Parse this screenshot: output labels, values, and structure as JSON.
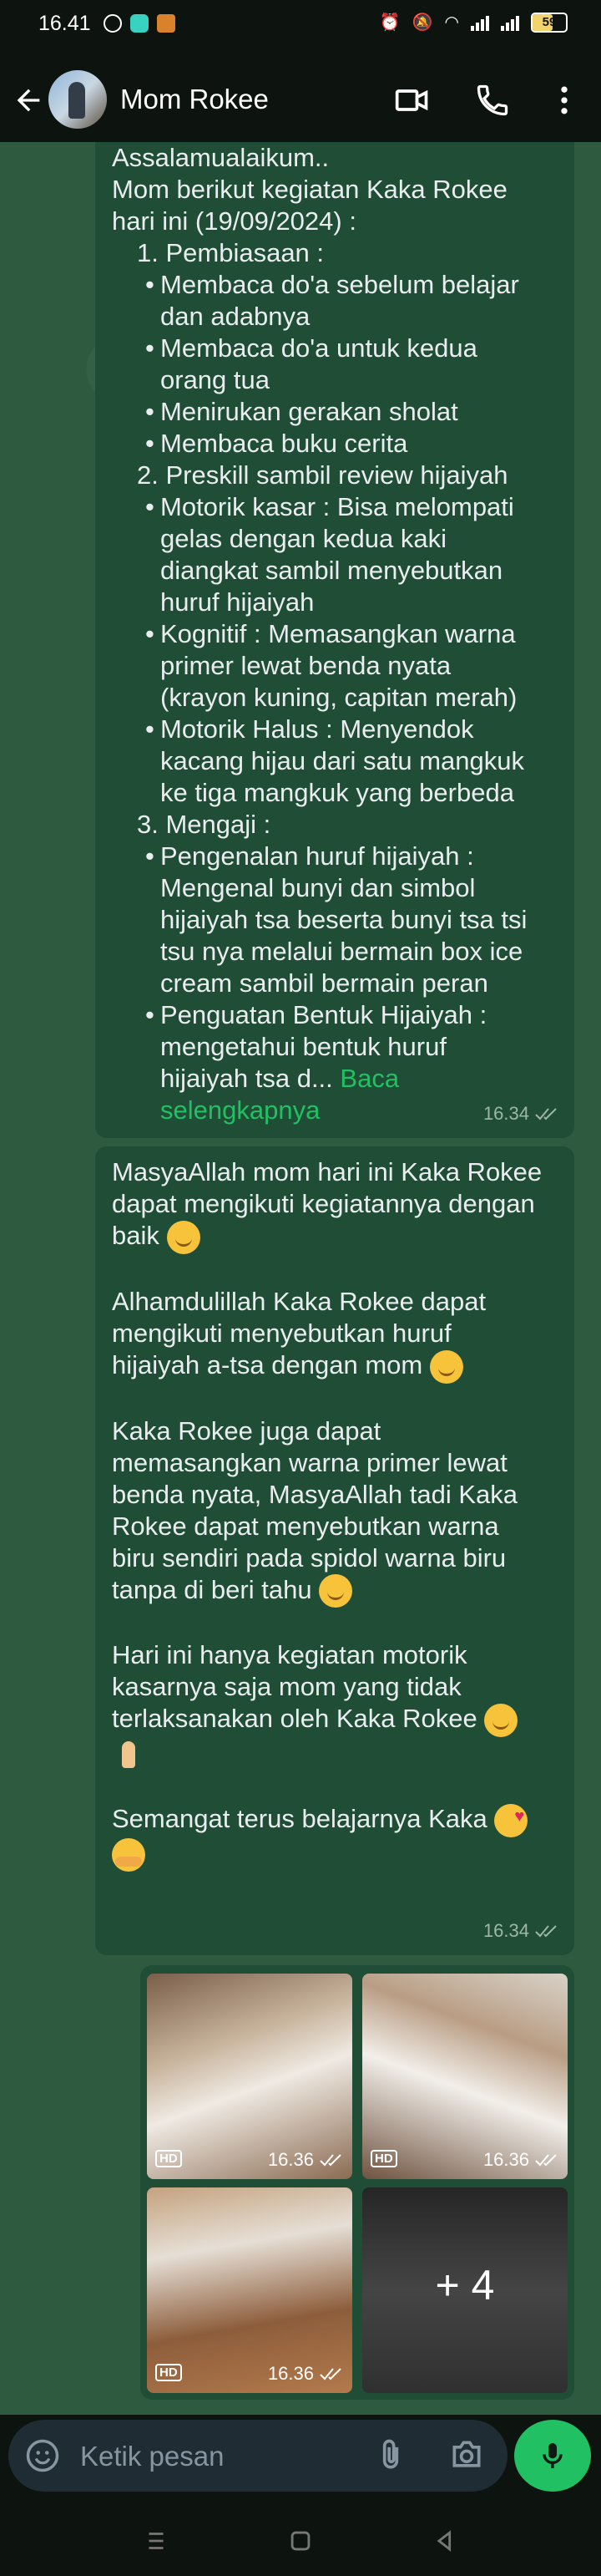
{
  "status_bar": {
    "time": "16.41",
    "battery": "59"
  },
  "header": {
    "contact_name": "Mom Rokee"
  },
  "message1": {
    "lines": [
      "Assalamualaikum..",
      "Mom berikut kegiatan Kaka Rokee",
      "hari ini (19/09/2024) :"
    ],
    "list": [
      {
        "kind": "num",
        "text": "1. Pembiasaan :"
      },
      {
        "kind": "bul",
        "text": [
          "Membaca do'a sebelum belajar",
          "dan adabnya"
        ]
      },
      {
        "kind": "bul",
        "text": [
          "Membaca do'a untuk kedua",
          "orang tua"
        ]
      },
      {
        "kind": "bul",
        "text": [
          "Menirukan gerakan sholat"
        ]
      },
      {
        "kind": "bul",
        "text": [
          "Membaca buku cerita"
        ]
      },
      {
        "kind": "num",
        "text": "2. Preskill sambil review hijaiyah"
      },
      {
        "kind": "bul",
        "text": [
          "Motorik kasar :   Bisa melompati",
          "gelas dengan kedua kaki",
          "diangkat sambil menyebutkan",
          "huruf hijaiyah"
        ]
      },
      {
        "kind": "bul",
        "text": [
          "Kognitif : Memasangkan warna",
          "primer lewat benda nyata",
          "(krayon kuning, capitan merah)"
        ]
      },
      {
        "kind": "bul",
        "text": [
          "Motorik Halus :   Menyendok",
          "kacang hijau dari satu mangkuk",
          "ke tiga mangkuk yang berbeda"
        ]
      },
      {
        "kind": "num",
        "text": "3. Mengaji :"
      },
      {
        "kind": "bul",
        "text": [
          "Pengenalan huruf hijaiyah :",
          "Mengenal bunyi dan simbol",
          "hijaiyah tsa beserta bunyi tsa tsi",
          "tsu nya melalui bermain box ice",
          "cream sambil bermain peran"
        ]
      },
      {
        "kind": "bul",
        "text": [
          "Penguatan Bentuk Hijaiyah :",
          "mengetahui bentuk huruf"
        ]
      }
    ],
    "last_line": "hijaiyah tsa d...",
    "read_more": "Baca",
    "read_more_2": "selengkapnya",
    "time": "16.34"
  },
  "message2": {
    "paragraphs": [
      [
        "MasyaAllah mom hari ini Kaka Rokee",
        "dapat mengikuti kegiatannya dengan",
        "baik"
      ],
      [
        "Alhamdulillah Kaka Rokee dapat",
        "mengikuti menyebutkan huruf",
        "hijaiyah a-tsa dengan mom"
      ],
      [
        "Kaka Rokee juga dapat",
        "memasangkan warna primer lewat",
        "benda nyata, MasyaAllah tadi Kaka",
        "Rokee dapat menyebutkan warna",
        "biru sendiri pada spidol warna biru",
        "tanpa di beri tahu"
      ],
      [
        "Hari ini hanya kegiatan motorik",
        "kasarnya saja mom yang tidak",
        "terlaksanakan oleh Kaka Rokee"
      ],
      [
        "Semangat terus belajarnya Kaka"
      ]
    ],
    "time": "16.34"
  },
  "media": {
    "hd_label": "HD",
    "time": "16.36",
    "more": "+ 4"
  },
  "input": {
    "placeholder": "Ketik pesan"
  },
  "colors": {
    "accent": "#21c063",
    "bubble": "#1f4d36",
    "bar": "#0d1410"
  }
}
